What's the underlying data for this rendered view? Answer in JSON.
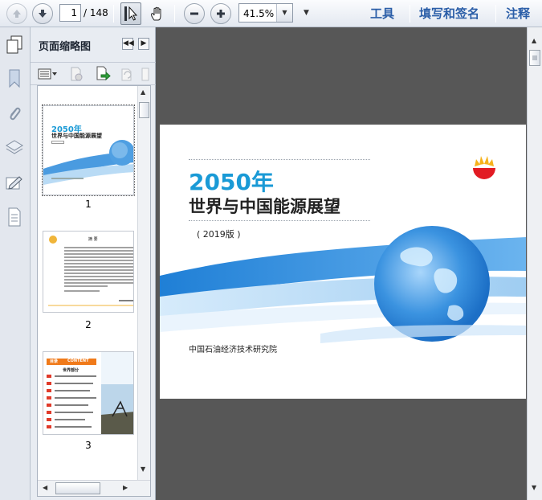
{
  "toolbar": {
    "current_page": "1",
    "total_pages": "/ 148",
    "zoom": "41.5%",
    "links": [
      "工具",
      "填写和签名",
      "注释"
    ]
  },
  "panel": {
    "title": "页面缩略图",
    "thumbnails": [
      {
        "label": "1"
      },
      {
        "label": "2"
      },
      {
        "label": "3"
      }
    ],
    "thumb1": {
      "year": "2050年",
      "title": "世界与中国能源展望"
    },
    "thumb2": {
      "heading": "摘 要"
    },
    "thumb3": {
      "menu": "目录",
      "content": "CONTENT",
      "section": "世界部分",
      "items": [
        "7",
        "11",
        "19",
        "25",
        "27",
        "35",
        "43",
        "48",
        "51",
        "54"
      ]
    }
  },
  "document": {
    "year_title": "2050年",
    "main_title": "世界与中国能源展望",
    "edition": "( 2019版 )",
    "institute": "中国石油经济技术研究院"
  },
  "colors": {
    "accent": "#1a9ad6",
    "viewport_bg": "#575757",
    "link": "#2b5ea8"
  }
}
